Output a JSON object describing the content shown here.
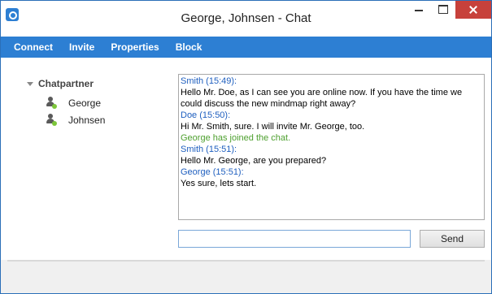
{
  "window": {
    "title": "George, Johnsen - Chat"
  },
  "menu": {
    "items": [
      "Connect",
      "Invite",
      "Properties",
      "Block"
    ]
  },
  "partners": {
    "header": "Chatpartner",
    "items": [
      {
        "name": "George",
        "status_color": "#7cc63a"
      },
      {
        "name": "Johnsen",
        "status_color": "#7cc63a"
      }
    ]
  },
  "chat": {
    "lines": [
      {
        "text": "Smith (15:49):",
        "color": "#1f5fbf"
      },
      {
        "text": "Hello Mr. Doe, as I can see you are online now. If you have the time we could discuss the new mindmap right away?",
        "color": "#000000"
      },
      {
        "text": "Doe (15:50):",
        "color": "#1f5fbf"
      },
      {
        "text": "Hi Mr. Smith, sure. I will invite Mr. George, too.",
        "color": "#000000"
      },
      {
        "text": "George has joined the chat.",
        "color": "#4ea02f"
      },
      {
        "text": "Smith (15:51):",
        "color": "#1f5fbf"
      },
      {
        "text": "Hello Mr. George, are you prepared?",
        "color": "#000000"
      },
      {
        "text": "George (15:51):",
        "color": "#1f5fbf"
      },
      {
        "text": "Yes sure, lets start.",
        "color": "#000000"
      }
    ]
  },
  "input": {
    "value": "",
    "placeholder": ""
  },
  "send_label": "Send",
  "colors": {
    "accent": "#2d7fd3",
    "close": "#c7413b"
  }
}
